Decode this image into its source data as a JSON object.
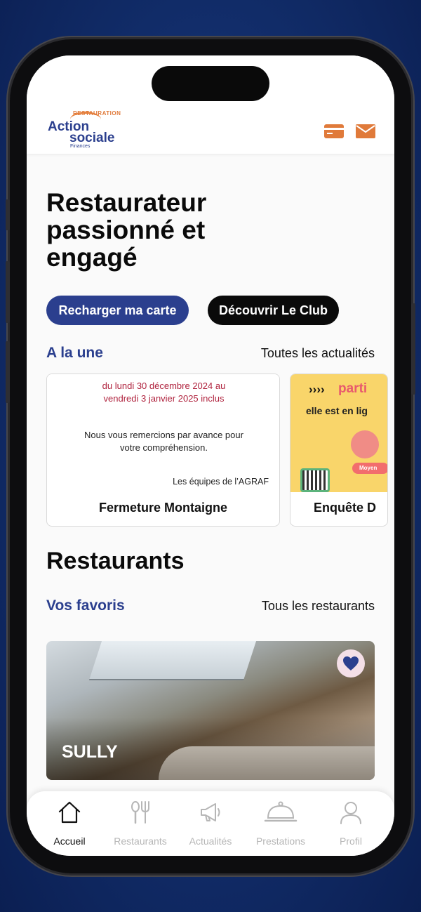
{
  "header": {
    "logo": {
      "superscript": "RESTAURATION",
      "line1": "Action",
      "line2": "sociale",
      "line3": "Finances"
    },
    "icons": [
      "card-icon",
      "mail-icon"
    ]
  },
  "hero": {
    "title": "Restaurateur passionné et engagé",
    "buttons": {
      "recharge": "Recharger ma carte",
      "club": "Découvrir Le Club"
    }
  },
  "news": {
    "heading": "A la une",
    "see_all": "Toutes les actualités",
    "cards": [
      {
        "image_text_red": "du lundi 30 décembre 2024 au vendredi 3 janvier 2025 inclus",
        "image_text_body": "Nous vous remercions par avance pour votre compréhension.",
        "image_text_sign": "Les équipes de l’AGRAF",
        "caption": "Fermeture Montaigne"
      },
      {
        "image_text_arrows": "››››",
        "image_text_word": "parti",
        "image_text_line": "elle est en lig",
        "image_text_pill": "Moyen",
        "caption": "Enquête D"
      }
    ]
  },
  "restaurants": {
    "heading": "Restaurants",
    "favorites_label": "Vos favoris",
    "see_all": "Tous les restaurants",
    "cards": [
      {
        "name": "SULLY",
        "favorite": true
      }
    ]
  },
  "tabbar": {
    "items": [
      {
        "label": "Accueil",
        "icon": "home-icon",
        "active": true
      },
      {
        "label": "Restaurants",
        "icon": "cutlery-icon",
        "active": false
      },
      {
        "label": "Actualités",
        "icon": "megaphone-icon",
        "active": false
      },
      {
        "label": "Prestations",
        "icon": "service-bell-icon",
        "active": false
      },
      {
        "label": "Profil",
        "icon": "person-icon",
        "active": false
      }
    ]
  },
  "colors": {
    "brand_blue": "#2b3f8e",
    "brand_orange": "#e07a3a",
    "black": "#0a0a0a",
    "background": "#fafafa"
  }
}
